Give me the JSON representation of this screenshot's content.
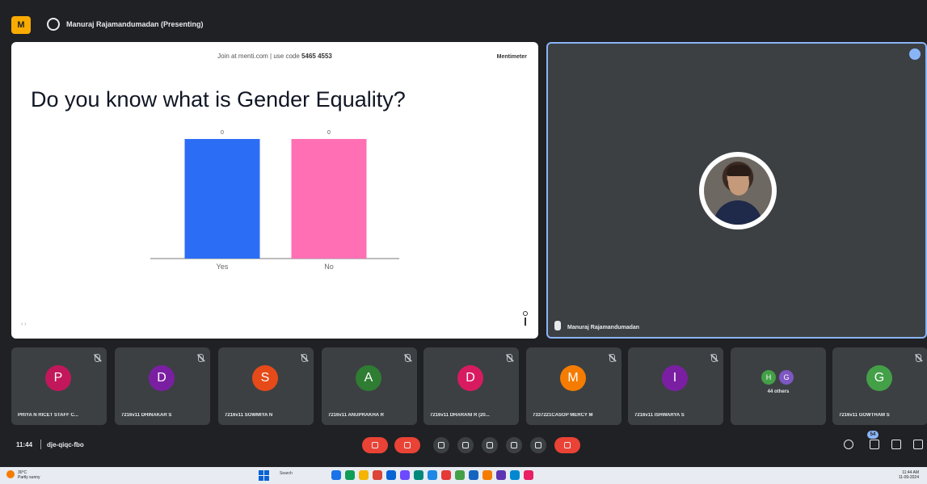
{
  "topbar": {
    "app_logo_glyph": "M",
    "presenting_label": "Manuraj Rajamandumadan (Presenting)"
  },
  "slide": {
    "join_text_prefix": "Join at menti.com | use code",
    "join_code": "5465 4553",
    "brand": "Mentimeter",
    "question": "Do you know what is Gender Equality?",
    "nav_text": "‹  ›"
  },
  "chart_data": {
    "type": "bar",
    "title": "",
    "categories": [
      "Yes",
      "No"
    ],
    "values": [
      0,
      0
    ],
    "bar_fill_levels": [
      1.0,
      1.0
    ],
    "colors": [
      "#2b6df5",
      "#ff6fb4"
    ],
    "data_labels": [
      "0",
      "0"
    ],
    "xlabel": "",
    "ylabel": ""
  },
  "presenter": {
    "name": "Manuraj Rajamandumadan",
    "pin_color": "#8ab4f8"
  },
  "participants": [
    {
      "initial": "P",
      "color": "#c2185b",
      "name": "PRIYA N RICET STAFF C..."
    },
    {
      "initial": "D",
      "color": "#7b1fa2",
      "name": "7216v11 DHINAKAR S"
    },
    {
      "initial": "S",
      "color": "#e64a19",
      "name": "7216v11 SOWMIYA N"
    },
    {
      "initial": "A",
      "color": "#2e7d32",
      "name": "7216v11 ANUPRAKHA R"
    },
    {
      "initial": "D",
      "color": "#d81b60",
      "name": "7216v11 DHARANI R (20..."
    },
    {
      "initial": "M",
      "color": "#f57c00",
      "name": "7337221CASOP MERCY M"
    },
    {
      "initial": "I",
      "color": "#7b1fa2",
      "name": "7216v11 ISHWARYA S"
    },
    {
      "initial": "G",
      "color": "#43a047",
      "name": "7216v11 GOWTHAM S"
    }
  ],
  "others": {
    "label": "44 others",
    "avatars": [
      {
        "initial": "H",
        "color": "#43a047"
      },
      {
        "initial": "G",
        "color": "#7e57c2"
      }
    ]
  },
  "controls": {
    "time": "11:44",
    "meeting_code": "dje-qiqc-fbo",
    "participant_count": "54"
  },
  "taskbar": {
    "weather_temp": "30°C",
    "weather_desc": "Partly sunny",
    "search_label": "Search",
    "tray_time": "11:44 AM",
    "tray_date": "11-09-2024"
  }
}
